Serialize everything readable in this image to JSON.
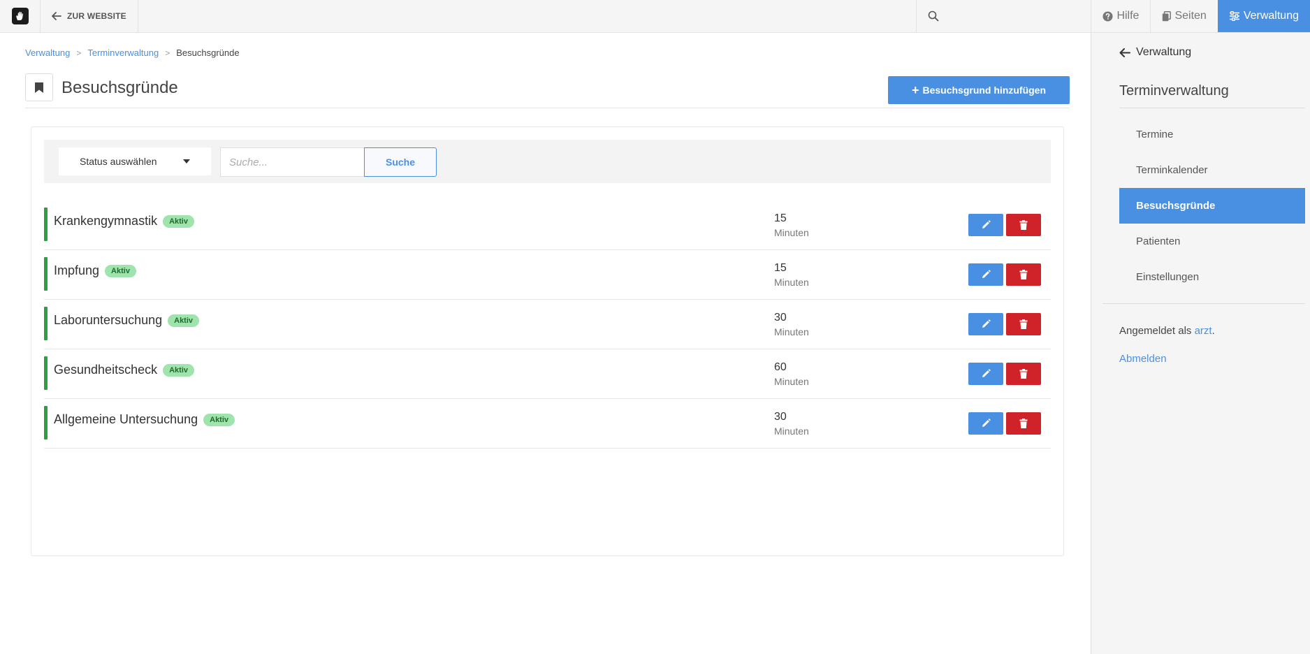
{
  "topbar": {
    "back_label": "ZUR WEBSITE",
    "search_placeholder": "",
    "help_label": "Hilfe",
    "pages_label": "Seiten",
    "admin_label": "Verwaltung"
  },
  "breadcrumb": {
    "items": [
      "Verwaltung",
      "Terminverwaltung"
    ],
    "separator": ">",
    "current": "Besuchsgründe"
  },
  "page": {
    "title": "Besuchsgründe",
    "add_button_label": "Besuchsgrund hinzufügen"
  },
  "filter": {
    "status_label": "Status auswählen",
    "search_placeholder": "Suche...",
    "search_button": "Suche"
  },
  "reasons": [
    {
      "name": "Krankengymnastik",
      "status": "Aktiv",
      "duration": "15",
      "unit": "Minuten"
    },
    {
      "name": "Impfung",
      "status": "Aktiv",
      "duration": "15",
      "unit": "Minuten"
    },
    {
      "name": "Laboruntersuchung",
      "status": "Aktiv",
      "duration": "30",
      "unit": "Minuten"
    },
    {
      "name": "Gesundheitscheck",
      "status": "Aktiv",
      "duration": "60",
      "unit": "Minuten"
    },
    {
      "name": "Allgemeine Untersuchung",
      "status": "Aktiv",
      "duration": "30",
      "unit": "Minuten"
    }
  ],
  "sidebar": {
    "back_label": "Verwaltung",
    "section_title": "Terminverwaltung",
    "items": [
      {
        "label": "Termine",
        "active": false
      },
      {
        "label": "Terminkalender",
        "active": false
      },
      {
        "label": "Besuchsgründe",
        "active": true
      },
      {
        "label": "Patienten",
        "active": false
      },
      {
        "label": "Einstellungen",
        "active": false
      }
    ],
    "logged_in_prefix": "Angemeldet als",
    "username": "arzt",
    "logged_in_suffix": ".",
    "logout_label": "Abmelden"
  },
  "colors": {
    "accent": "#4a90e2",
    "danger": "#cf2229",
    "status_bar": "#2e9e3e",
    "badge_bg": "#9fe3ad"
  },
  "icons": {
    "logo": "hand-logo-icon",
    "back": "arrow-left-icon",
    "search": "search-icon",
    "help": "question-circle-icon",
    "pages": "copy-icon",
    "admin": "sliders-icon",
    "page": "bookmark-icon",
    "edit": "pencil-icon",
    "delete": "trash-icon"
  }
}
